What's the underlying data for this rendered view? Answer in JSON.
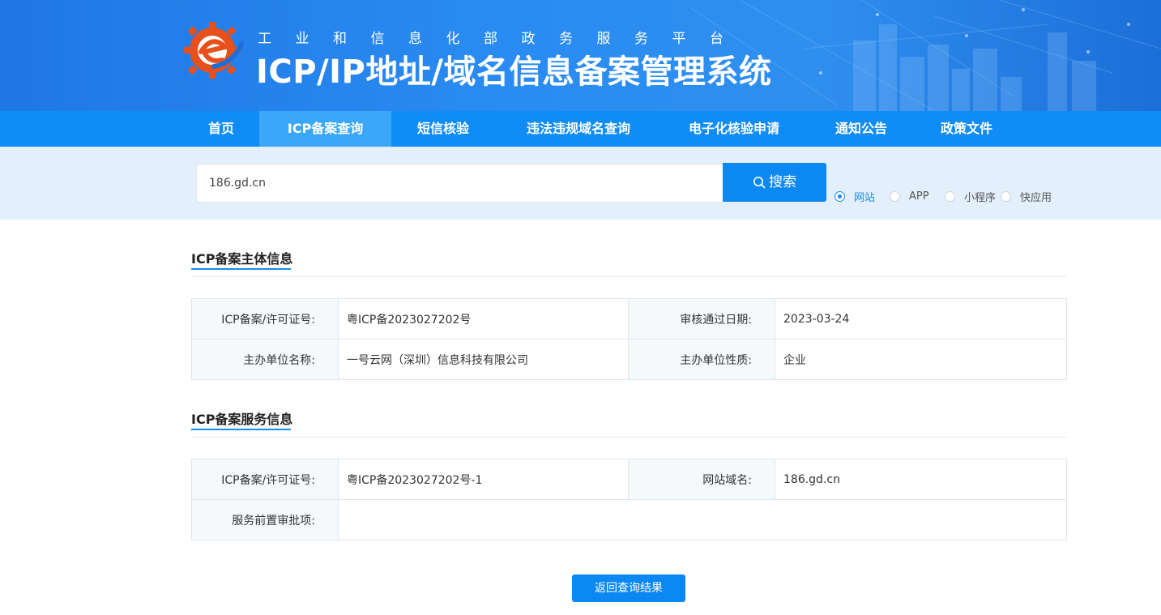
{
  "header": {
    "org_name": "工业和信息化部政务服务平台",
    "system_title": "ICP/IP地址/域名信息备案管理系统"
  },
  "nav": {
    "items": [
      "首页",
      "ICP备案查询",
      "短信核验",
      "违法违规域名查询",
      "电子化核验申请",
      "通知公告",
      "政策文件"
    ],
    "active": "ICP备案查询"
  },
  "search": {
    "value": "186.gd.cn",
    "button_label": "搜索",
    "types": [
      "网站",
      "APP",
      "小程序",
      "快应用"
    ],
    "selected_type": "网站"
  },
  "subject_section": {
    "title": "ICP备案主体信息",
    "rows": [
      [
        {
          "k": "ICP备案/许可证号:",
          "v": "粤ICP备2023027202号"
        },
        {
          "k": "审核通过日期:",
          "v": "2023-03-24"
        }
      ],
      [
        {
          "k": "主办单位名称:",
          "v": "一号云网（深圳）信息科技有限公司"
        },
        {
          "k": "主办单位性质:",
          "v": "企业"
        }
      ]
    ]
  },
  "service_section": {
    "title": "ICP备案服务信息",
    "license_label": "ICP备案/许可证号:",
    "license_value": "粤ICP备2023027202号-1",
    "domain_label": "网站域名:",
    "domain_value": "186.gd.cn",
    "preapproval_label": "服务前置审批项:",
    "preapproval_value": ""
  },
  "back_button": "返回查询结果",
  "colors": {
    "primary": "#0c88f2",
    "nav_bg": "#0f8cf5",
    "nav_active": "#3aa7f8",
    "band_bg": "#e3effa"
  }
}
